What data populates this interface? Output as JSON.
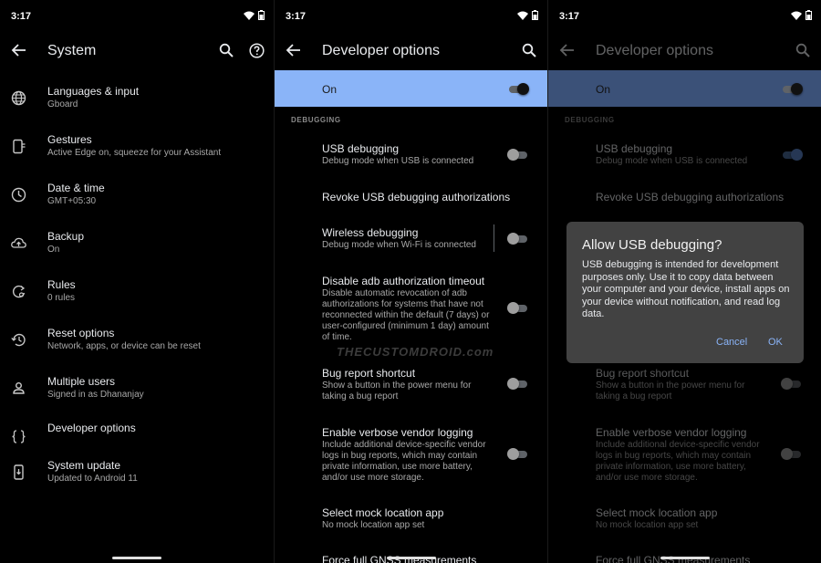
{
  "status": {
    "time": "3:17"
  },
  "system_screen": {
    "title": "System",
    "items": [
      {
        "icon": "globe-icon",
        "title": "Languages & input",
        "subtitle": "Gboard"
      },
      {
        "icon": "gestures-icon",
        "title": "Gestures",
        "subtitle": "Active Edge on, squeeze for your Assistant"
      },
      {
        "icon": "clock-icon",
        "title": "Date & time",
        "subtitle": "GMT+05:30"
      },
      {
        "icon": "cloud-upload-icon",
        "title": "Backup",
        "subtitle": "On"
      },
      {
        "icon": "rules-icon",
        "title": "Rules",
        "subtitle": "0 rules"
      },
      {
        "icon": "history-icon",
        "title": "Reset options",
        "subtitle": "Network, apps, or device can be reset"
      },
      {
        "icon": "person-icon",
        "title": "Multiple users",
        "subtitle": "Signed in as Dhananjay"
      },
      {
        "icon": "braces-icon",
        "title": "Developer options",
        "subtitle": ""
      },
      {
        "icon": "system-update-icon",
        "title": "System update",
        "subtitle": "Updated to Android 11"
      }
    ]
  },
  "dev_screen": {
    "title": "Developer options",
    "on_label": "On",
    "section": "DEBUGGING",
    "items": [
      {
        "title": "USB debugging",
        "subtitle": "Debug mode when USB is connected",
        "toggle": "off"
      },
      {
        "title": "Revoke USB debugging authorizations",
        "subtitle": "",
        "toggle": "none"
      },
      {
        "title": "Wireless debugging",
        "subtitle": "Debug mode when Wi-Fi is connected",
        "toggle": "off"
      },
      {
        "title": "Disable adb authorization timeout",
        "subtitle": "Disable automatic revocation of adb authorizations for systems that have not reconnected within the default (7 days) or user-configured (minimum 1 day) amount of time.",
        "toggle": "off"
      },
      {
        "title": "Bug report shortcut",
        "subtitle": "Show a button in the power menu for taking a bug report",
        "toggle": "off"
      },
      {
        "title": "Enable verbose vendor logging",
        "subtitle": "Include additional device-specific vendor logs in bug reports, which may contain private information, use more battery, and/or use more storage.",
        "toggle": "off"
      },
      {
        "title": "Select mock location app",
        "subtitle": "No mock location app set",
        "toggle": "none"
      },
      {
        "title": "Force full GNSS measurements",
        "subtitle": "",
        "toggle": "none"
      }
    ]
  },
  "watermark": "THECUSTOMDROID.com",
  "dialog": {
    "title": "Allow USB debugging?",
    "body": "USB debugging is intended for development purposes only. Use it to copy data between your computer and your device, install apps on your device without notification, and read log data.",
    "cancel": "Cancel",
    "ok": "OK"
  },
  "colors": {
    "accent": "#8ab4f8",
    "background": "#000000",
    "dialog": "#424242"
  }
}
